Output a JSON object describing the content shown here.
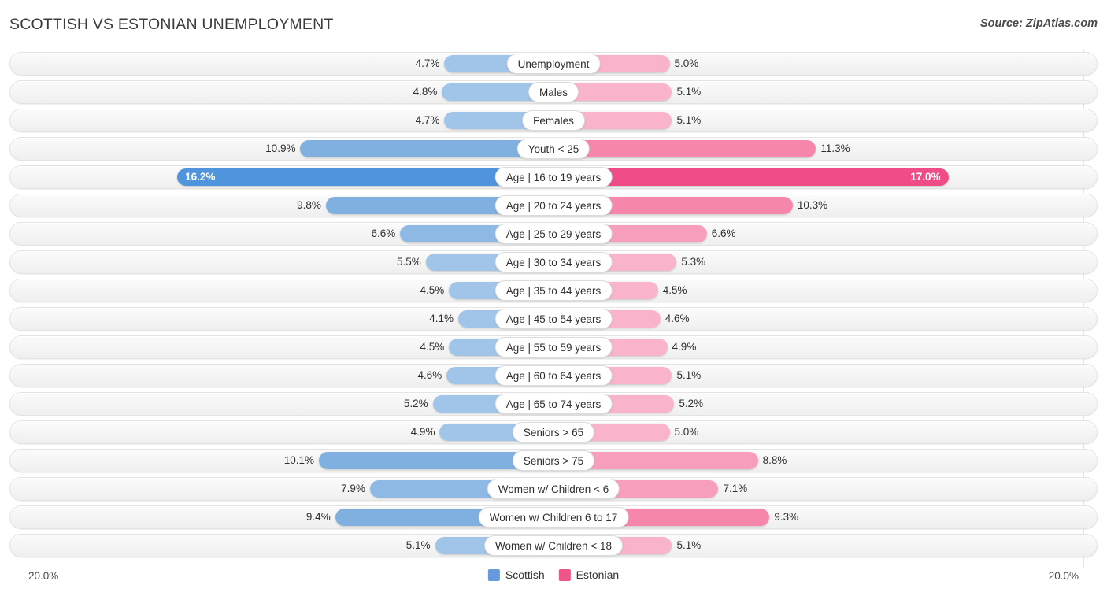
{
  "header": {
    "title": "SCOTTISH VS ESTONIAN UNEMPLOYMENT",
    "source": "Source: ZipAtlas.com"
  },
  "axis": {
    "left_max_label": "20.0%",
    "right_max_label": "20.0%",
    "max_value": 20.0
  },
  "legend": {
    "items": [
      {
        "label": "Scottish",
        "color": "#6699dd"
      },
      {
        "label": "Estonian",
        "color": "#ee5588"
      }
    ]
  },
  "colors": {
    "scottish_light": "#a1c5e8",
    "scottish_mid": "#7fb0e0",
    "scottish_strong": "#4f94dd",
    "estonian_light": "#f9b3ca",
    "estonian_mid": "#f786ab",
    "estonian_strong": "#f04c87",
    "track": "#f4f4f4",
    "pill": "#ffffff"
  },
  "chart_data": {
    "type": "bar",
    "subtype": "diverging-bidirectional",
    "title": "SCOTTISH VS ESTONIAN UNEMPLOYMENT",
    "xlabel": "",
    "ylabel": "",
    "xlim": [
      20.0,
      20.0
    ],
    "grid": false,
    "legend_position": "bottom-center",
    "unit": "%",
    "categories": [
      "Unemployment",
      "Males",
      "Females",
      "Youth < 25",
      "Age | 16 to 19 years",
      "Age | 20 to 24 years",
      "Age | 25 to 29 years",
      "Age | 30 to 34 years",
      "Age | 35 to 44 years",
      "Age | 45 to 54 years",
      "Age | 55 to 59 years",
      "Age | 60 to 64 years",
      "Age | 65 to 74 years",
      "Seniors > 65",
      "Seniors > 75",
      "Women w/ Children < 6",
      "Women w/ Children 6 to 17",
      "Women w/ Children < 18"
    ],
    "series": [
      {
        "name": "Scottish",
        "color": "#6699dd",
        "values": [
          4.7,
          4.8,
          4.7,
          10.9,
          16.2,
          9.8,
          6.6,
          5.5,
          4.5,
          4.1,
          4.5,
          4.6,
          5.2,
          4.9,
          10.1,
          7.9,
          9.4,
          5.1
        ],
        "labels": [
          "4.7%",
          "4.8%",
          "4.7%",
          "10.9%",
          "16.2%",
          "9.8%",
          "6.6%",
          "5.5%",
          "4.5%",
          "4.1%",
          "4.5%",
          "4.6%",
          "5.2%",
          "4.9%",
          "10.1%",
          "7.9%",
          "9.4%",
          "5.1%"
        ]
      },
      {
        "name": "Estonian",
        "color": "#ee5588",
        "values": [
          5.0,
          5.1,
          5.1,
          11.3,
          17.0,
          10.3,
          6.6,
          5.3,
          4.5,
          4.6,
          4.9,
          5.1,
          5.2,
          5.0,
          8.8,
          7.1,
          9.3,
          5.1
        ],
        "labels": [
          "5.0%",
          "5.1%",
          "5.1%",
          "11.3%",
          "17.0%",
          "10.3%",
          "6.6%",
          "5.3%",
          "4.5%",
          "4.6%",
          "4.9%",
          "5.1%",
          "5.2%",
          "5.0%",
          "8.8%",
          "7.1%",
          "9.3%",
          "5.1%"
        ]
      }
    ]
  }
}
